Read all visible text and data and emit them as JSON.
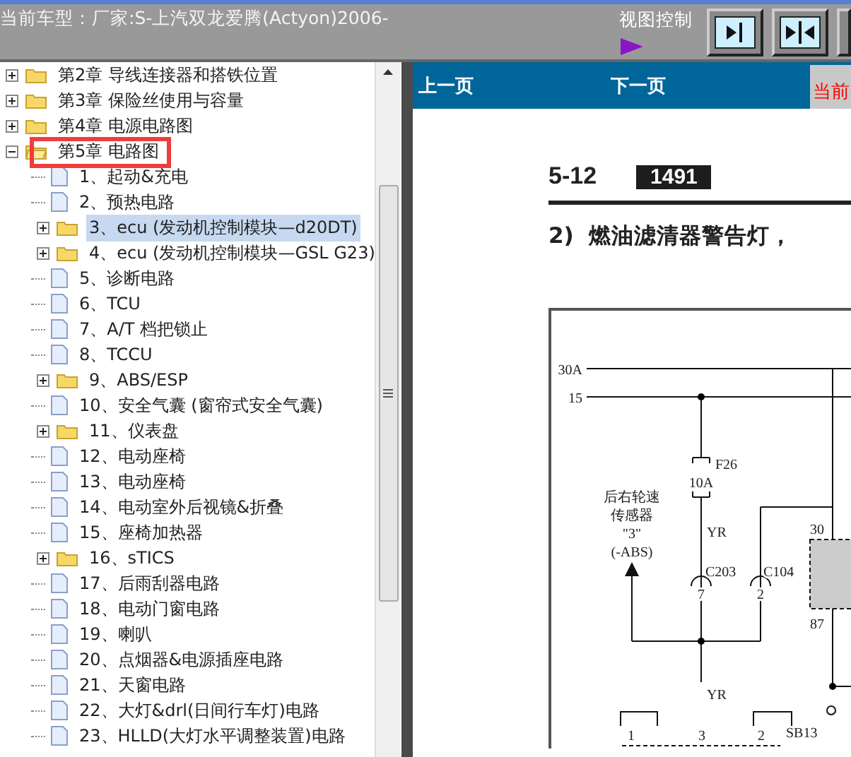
{
  "header": {
    "title": "当前车型：厂家:S-上汽双龙爱腾(Actyon)2006-",
    "view_control": "视图控制"
  },
  "tree": [
    {
      "label": "第2章 导线连接器和搭铁位置",
      "expanded": false,
      "highlighted": false
    },
    {
      "label": "第3章 保险丝使用与容量",
      "expanded": false,
      "highlighted": false
    },
    {
      "label": "第4章 电源电路图",
      "expanded": false,
      "highlighted": false
    },
    {
      "label": "第5章 电路图",
      "expanded": true,
      "highlighted": true,
      "children": [
        {
          "label": "1、起动&充电",
          "kind": "page",
          "selected": false
        },
        {
          "label": "2、预热电路",
          "kind": "page",
          "selected": false
        },
        {
          "label": "3、ecu (发动机控制模块—d20DT)",
          "kind": "folder",
          "expanded": false,
          "selected": true
        },
        {
          "label": "4、ecu (发动机控制模块—GSL G23)",
          "kind": "folder",
          "expanded": false,
          "selected": false
        },
        {
          "label": "5、诊断电路",
          "kind": "page",
          "selected": false
        },
        {
          "label": "6、TCU",
          "kind": "page",
          "selected": false
        },
        {
          "label": "7、A/T 档把锁止",
          "kind": "page",
          "selected": false
        },
        {
          "label": "8、TCCU",
          "kind": "page",
          "selected": false
        },
        {
          "label": "9、ABS/ESP",
          "kind": "folder",
          "expanded": false,
          "selected": false
        },
        {
          "label": "10、安全气囊 (窗帘式安全气囊)",
          "kind": "page",
          "selected": false
        },
        {
          "label": "11、仪表盘",
          "kind": "folder",
          "expanded": false,
          "selected": false
        },
        {
          "label": "12、电动座椅",
          "kind": "page",
          "selected": false
        },
        {
          "label": "13、电动座椅",
          "kind": "page",
          "selected": false
        },
        {
          "label": "14、电动室外后视镜&折叠",
          "kind": "page",
          "selected": false
        },
        {
          "label": "15、座椅加热器",
          "kind": "page",
          "selected": false
        },
        {
          "label": "16、sTICS",
          "kind": "folder",
          "expanded": false,
          "selected": false
        },
        {
          "label": "17、后雨刮器电路",
          "kind": "page",
          "selected": false
        },
        {
          "label": "18、电动门窗电路",
          "kind": "page",
          "selected": false
        },
        {
          "label": "19、喇叭",
          "kind": "page",
          "selected": false
        },
        {
          "label": "20、点烟器&电源插座电路",
          "kind": "page",
          "selected": false
        },
        {
          "label": "21、天窗电路",
          "kind": "page",
          "selected": false
        },
        {
          "label": "22、大灯&drl(日间行车灯)电路",
          "kind": "page",
          "selected": false
        },
        {
          "label": "23、HLLD(大灯水平调整装置)电路",
          "kind": "page",
          "selected": false
        }
      ]
    }
  ],
  "nav": {
    "prev": "上一页",
    "next": "下一页",
    "current": "当前"
  },
  "document": {
    "page_number": "5-12",
    "page_code": "1491",
    "heading": "2)  燃油滤清器警告灯，",
    "diagram_labels": [
      "30A",
      "15",
      "F26",
      "10A",
      "后右轮速",
      "传感器",
      "\"3\"",
      "(-ABS)",
      "YR",
      "C203",
      "7",
      "C104",
      "2",
      "30",
      "87",
      "YR",
      "1",
      "3",
      "2",
      "SB13"
    ]
  }
}
